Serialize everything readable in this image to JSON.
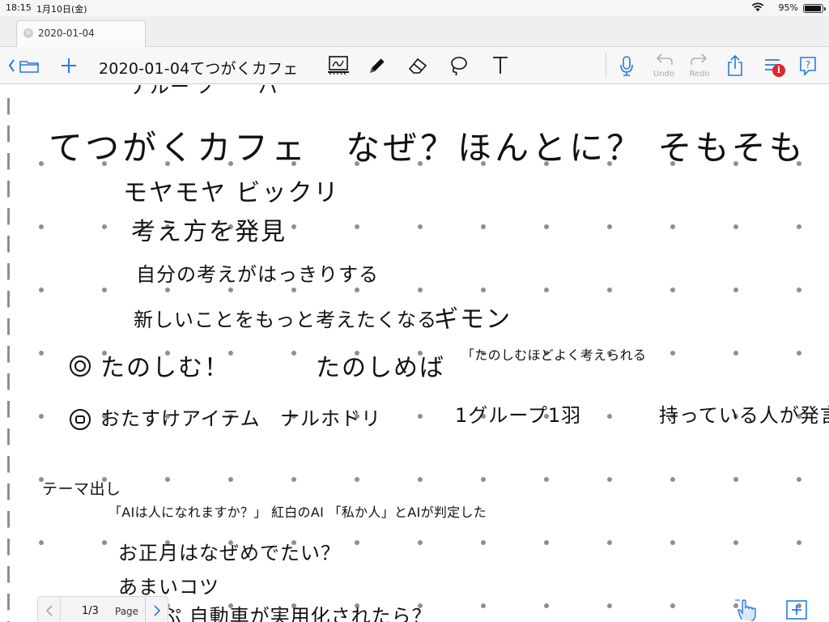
{
  "status_bar": {
    "time": "18:15",
    "date": "1月10日(金)",
    "battery_percent": "95%",
    "battery_level": 0.95
  },
  "tab": {
    "title": "2020-01-04"
  },
  "toolbar": {
    "document_title": "2020-01-04てつがくカフェ",
    "undo_label": "Undo",
    "redo_label": "Redo",
    "notification_badge": "i",
    "accent_color": "#2a7ae2"
  },
  "notes": {
    "heading": "てつがくカフェ　なぜ？ほんとに？ そもそも",
    "items": [
      "モヤモヤ ビックリ",
      "考え方を発見",
      "自分の考えがはっきりする",
      "新しいことをもっと考えたくなる",
      "ギモン"
    ],
    "bullet1": "たのしむ！",
    "bullet1_note": "たのしめば",
    "bullet1_sub": "「たのしむほどよく考えられる",
    "bullet2": "おたすけアイテム",
    "bullet2_items": [
      "ナルホドリ",
      "1グループ1羽",
      "持っている人が発言"
    ],
    "theme_header": "テーマ出し",
    "theme_line1": "「AIは人になれますか？」 紅白のAI 「私か人」とAIが判定した",
    "theme_line2": "お正月はなぜめでたい？",
    "theme_line3": "あまいコツ",
    "theme_line4": "ぷ 自動車が実用化されたら？"
  },
  "pager": {
    "page_indicator": "1/3",
    "page_label": "Page"
  }
}
